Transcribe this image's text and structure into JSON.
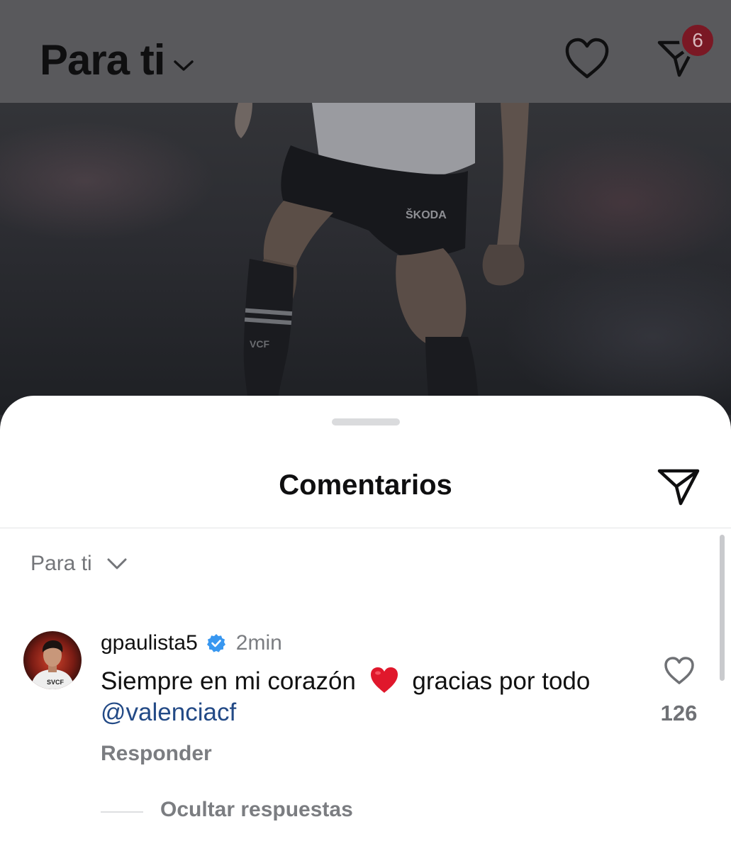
{
  "header": {
    "feed_title": "Para ti",
    "notifications_badge": "6"
  },
  "icons": {
    "activity": "heart-outline-icon",
    "direct": "paper-plane-icon",
    "chevron": "chevron-down-icon",
    "verified": "verified-badge-icon"
  },
  "photo": {
    "jersey_sponsor": "ŠKODA",
    "sock_text": "VCF"
  },
  "sheet": {
    "title": "Comentarios",
    "sort_label": "Para ti"
  },
  "comment": {
    "username": "gpaulista5",
    "time": "2min",
    "text_before": "Siempre en mi corazón",
    "text_after": "gracias por todo",
    "mention": "@valenciacf",
    "likes": "126",
    "reply_label": "Responder",
    "hide_replies_label": "Ocultar respuestas",
    "avatar_text": "SVCF"
  },
  "colors": {
    "badge": "#7a1824",
    "mention": "#234a86",
    "verified": "#3897f0",
    "heart_emoji": "#e0182c"
  }
}
